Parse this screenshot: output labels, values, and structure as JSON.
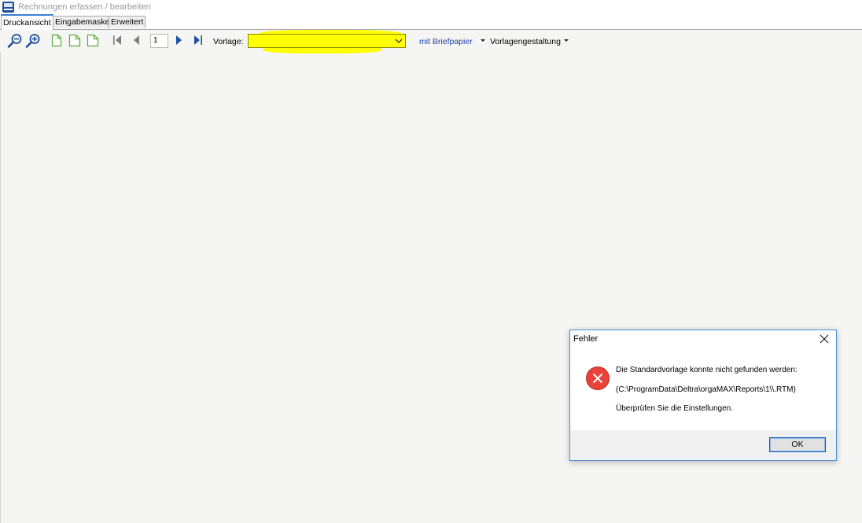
{
  "window": {
    "title": "Rechnungen erfassen / bearbeiten",
    "app_icon": "orgamax-logo-icon"
  },
  "tabs": [
    {
      "label": "Druckansicht",
      "active": true
    },
    {
      "label": "Eingabemaske",
      "active": false
    },
    {
      "label": "Erweitert",
      "active": false
    }
  ],
  "toolbar": {
    "page_number": "1",
    "vorlage_label": "Vorlage:",
    "vorlage_value": "",
    "briefpapier": "mit Briefpapier",
    "vorlagengestaltung": "Vorlagengestaltung",
    "highlight_color": "#ffff00",
    "icon_color_zoom": "#1d4f9e",
    "icon_color_page": "#5aa832"
  },
  "dialog": {
    "title": "Fehler",
    "line1": "Die Standardvorlage konnte nicht gefunden werden:",
    "line2": "(C:\\ProgramData\\Deltra\\orgaMAX\\Reports\\1\\\\.RTM)",
    "line3": "Überprüfen Sie die Einstellungen.",
    "ok_label": "OK",
    "error_color": "#e8423a"
  }
}
